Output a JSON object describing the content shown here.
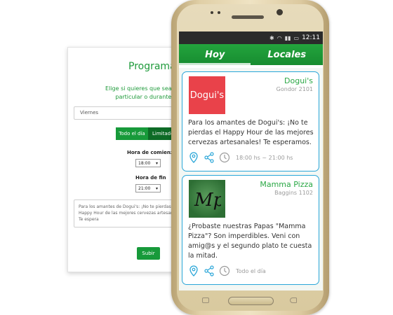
{
  "form": {
    "title": "Programar",
    "description_line1": "Elige si quieres que sea válido du",
    "description_line2": "particular o durante toda l",
    "day_select": "Viernes",
    "toggle_all_day": "Todo el día",
    "toggle_limited": "Limitado",
    "start_label": "Hora de comienzo",
    "start_value": "18:00",
    "end_label": "Hora de fin",
    "end_value": "21:00",
    "message": "Para los amantes de Dogui's: ¡No te pierdas el Happy Hour de las mejores cervezas artesanales! Te espera",
    "submit_label": "Subir"
  },
  "phone": {
    "clock": "12:11",
    "tabs": [
      {
        "label": "Hoy"
      },
      {
        "label": "Locales"
      }
    ]
  },
  "cards": [
    {
      "name": "Dogui's",
      "address": "Gondor 2101",
      "image_label": "Dogui's",
      "text": "Para los amantes de Dogui's: ¡No te pierdas el Happy Hour de las mejores cervezas artesanales! Te esperamos.",
      "time": "18:00 hs ~ 21:00 hs"
    },
    {
      "name": "Mamma Pizza",
      "address": "Baggins 1102",
      "text": "¿Probaste nuestras Papas \"Mamma Pizza\"? Son imperdibles. Veni con amig@s y el segundo plato te cuesta la mitad.",
      "time": "Todo el día"
    }
  ],
  "colors": {
    "brand_green": "#1e9a3a",
    "card_border": "#2aa6d8",
    "doguis_red": "#e9424a"
  }
}
